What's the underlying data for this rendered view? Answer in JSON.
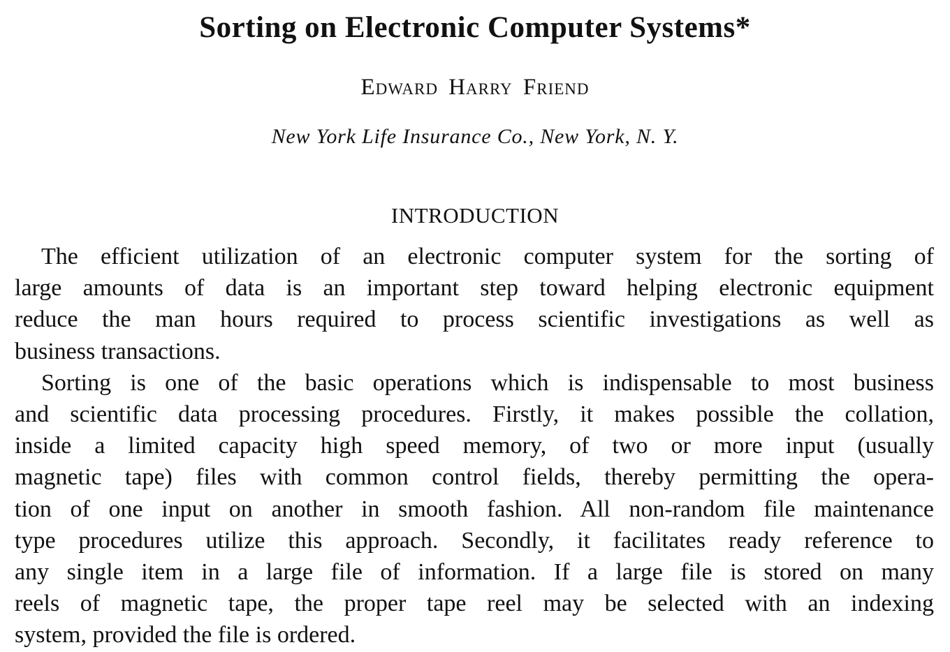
{
  "article": {
    "title": "Sorting on Electronic Computer Systems*",
    "author": "Edward Harry Friend",
    "affiliation": "New York Life Insurance Co., New York, N. Y.",
    "section_heading": "INTRODUCTION",
    "paragraphs": [
      {
        "lines": [
          "The efficient utilization of an electronic computer system for the sorting of",
          "large amounts of data is an important step toward helping electronic equipment",
          "reduce the man hours required to process scientific investigations as well as",
          "business transactions."
        ]
      },
      {
        "lines": [
          "Sorting is one of the basic operations which is indispensable to most business",
          "and scientific data processing procedures. Firstly, it makes possible the collation,",
          "inside a limited capacity high speed memory, of two or more input (usually",
          "magnetic tape) files with common control fields, thereby permitting the opera-",
          "tion of one input on another in smooth fashion. All non-random file maintenance",
          "type procedures utilize this approach. Secondly, it facilitates ready reference to",
          "any single item in a large file of information. If a large file is stored on many",
          "reels of magnetic tape, the proper tape reel may be selected with an indexing",
          "system, provided the file is ordered."
        ]
      }
    ]
  }
}
